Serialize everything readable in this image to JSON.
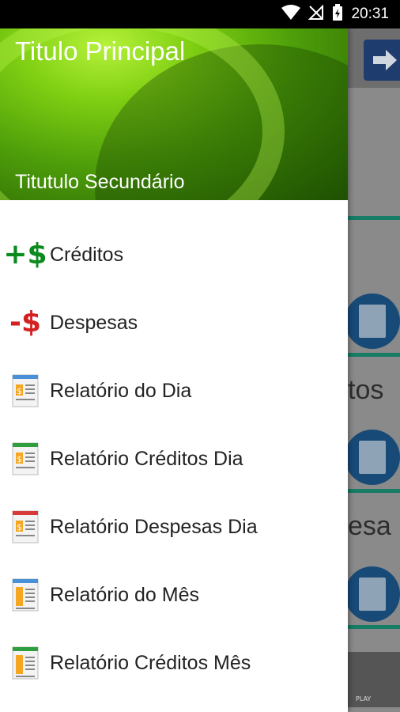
{
  "status_bar": {
    "time": "20:31",
    "icons": [
      "wifi-icon",
      "no-signal-icon",
      "battery-charging-icon"
    ]
  },
  "drawer": {
    "title": "Titulo Principal",
    "subtitle": "Titutulo Secundário",
    "items": [
      {
        "label": "Créditos",
        "icon": "dollar-plus-icon"
      },
      {
        "label": "Despesas",
        "icon": "dollar-minus-icon"
      },
      {
        "label": "Relatório do Dia",
        "icon": "report-icon",
        "accent": "#4a90d9"
      },
      {
        "label": "Relatório Créditos Dia",
        "icon": "report-credit-icon",
        "accent": "#2e9e3e"
      },
      {
        "label": "Relatório Despesas Dia",
        "icon": "report-expense-icon",
        "accent": "#d83a3a"
      },
      {
        "label": "Relatório do Mês",
        "icon": "report-month-icon",
        "accent": "#4a90d9"
      },
      {
        "label": "Relatório Créditos Mês",
        "icon": "report-credit-month-icon",
        "accent": "#2e9e3e"
      }
    ]
  },
  "background": {
    "text_fragments": [
      "tos",
      "esa"
    ],
    "bottom_label": "PLAY"
  },
  "colors": {
    "header_green": "#5fb30f",
    "teal_divider": "#167c66",
    "status_bar": "#000000"
  }
}
